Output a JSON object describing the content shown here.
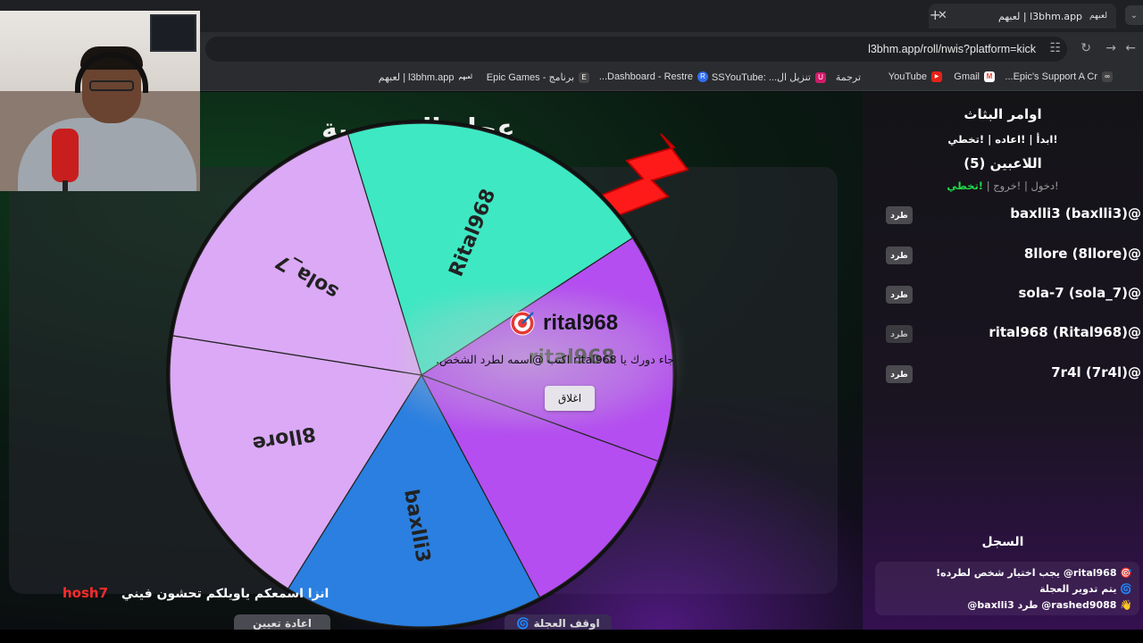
{
  "browser": {
    "tab_title": "l3bhm.app | لعبهم",
    "tab_favicon": "لعبهم",
    "url": "l3bhm.app/roll/nwis?platform=kick",
    "bookmarks": [
      {
        "label": "l3bhm.app | لعبهم",
        "icon": "لعبهم",
        "color": "#2b2c30"
      },
      {
        "label": "برنامج - Epic Games",
        "icon": "E",
        "color": "#444"
      },
      {
        "label": "Dashboard - Restre...",
        "icon": "R",
        "color": "#2f6ef5"
      },
      {
        "label": "تنزيل ال... :SSYouTube",
        "icon": "U",
        "color": "#d11a6a"
      },
      {
        "label": "ترجمة",
        "icon": "",
        "color": "#2b2c30"
      },
      {
        "label": "YouTube",
        "icon": "▶",
        "color": "#e62117"
      },
      {
        "label": "Gmail",
        "icon": "M",
        "color": "#ea4335"
      },
      {
        "label": "Epic's Support A Cr...",
        "icon": "∞",
        "color": "#444"
      }
    ]
  },
  "page": {
    "title": "عجلة الشخصية"
  },
  "sidebar": {
    "title": "اوامر البثاث",
    "commands": "!ابدأ | !اعاده | !تخطي",
    "players_title": "اللاعبين (5)",
    "player_cmds": {
      "join": "!دخول",
      "exit": "!خروج",
      "skip": "!تخطي"
    },
    "kick_label": "طرد",
    "players": [
      "baxlli3 (baxlli3)@",
      "8llore (8llore)@",
      "sola-7 (sola_7)@",
      "rital968 (Rital968)@",
      "7r4l (7r4l)@"
    ],
    "log_title": "السجل",
    "log": [
      "🎯 rital968@ يجب اختيار شخص لطرده!",
      "🌀 يتم تدوير العجلة",
      "👋 rashed9088@ طرد baxlli3@"
    ]
  },
  "wheel": {
    "labels": [
      "Rital968",
      "rital968",
      "",
      "baxlli3",
      "8llore",
      "sola_7"
    ],
    "colors": [
      "#3ee8c3",
      "#b44ef0",
      "#b44ef0",
      "#2a7fe0",
      "#dba9f5",
      "#dba9f5"
    ]
  },
  "popup": {
    "name": "rital968",
    "message": "جاء دورك يا rital968 اكتب @اسمه لطرد الشخص.",
    "close_label": "اغلاق"
  },
  "chat": {
    "user": "hosh7",
    "text": "انزا اسمعكم ياويلكم تحشون فيني"
  },
  "bottom_buttons": {
    "restart": "اعادة تعيين",
    "stop": "🌀 اوقف العجلة"
  }
}
